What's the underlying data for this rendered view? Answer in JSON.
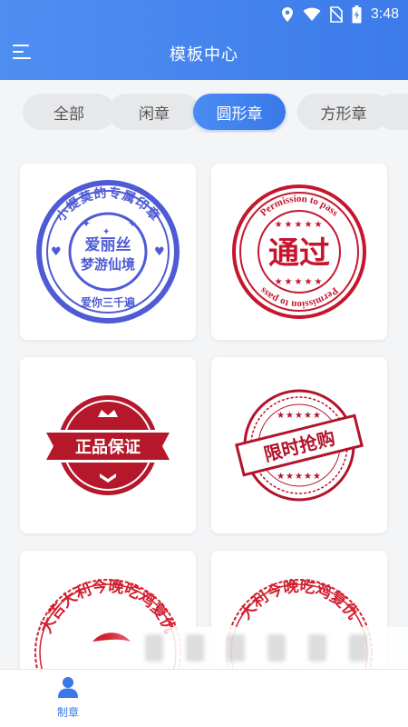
{
  "status_bar": {
    "time": "3:48",
    "icons": [
      "location-icon",
      "wifi-icon",
      "no-sim-icon",
      "battery-charging-icon"
    ]
  },
  "header": {
    "title": "模板中心",
    "menu_icon": "menu-icon"
  },
  "tabs": [
    {
      "label": "全部",
      "active": false
    },
    {
      "label": "闲章",
      "active": false
    },
    {
      "label": "圆形章",
      "active": true
    },
    {
      "label": "方形章",
      "active": false
    },
    {
      "label": "",
      "active": false
    }
  ],
  "templates": [
    {
      "id": "stamp-blue",
      "color": "#4f5bd5",
      "arc_text": "小提莫的专属印章",
      "line1": "爱丽丝",
      "line2": "梦游仙境",
      "bottom_text": "爱你三千遍"
    },
    {
      "id": "stamp-pass",
      "color": "#c5162e",
      "arc_text": "Permission to pass",
      "center_text": "通过",
      "bottom_arc": "Permission to pass"
    },
    {
      "id": "stamp-genuine",
      "color": "#b5182b",
      "center_text": "正品保证"
    },
    {
      "id": "stamp-limited",
      "color": "#b2132a",
      "center_text": "限时抢购"
    },
    {
      "id": "stamp-red-1",
      "color": "#d11f2f",
      "arc_text": "大吉大利今晚吃鸡复仇"
    },
    {
      "id": "stamp-red-2",
      "color": "#d11f2f",
      "arc_text": "大利今晚吃鸡复仇"
    }
  ],
  "bottom_nav": {
    "label": "制章",
    "icon": "user-icon",
    "accent": "#3a78e8"
  }
}
